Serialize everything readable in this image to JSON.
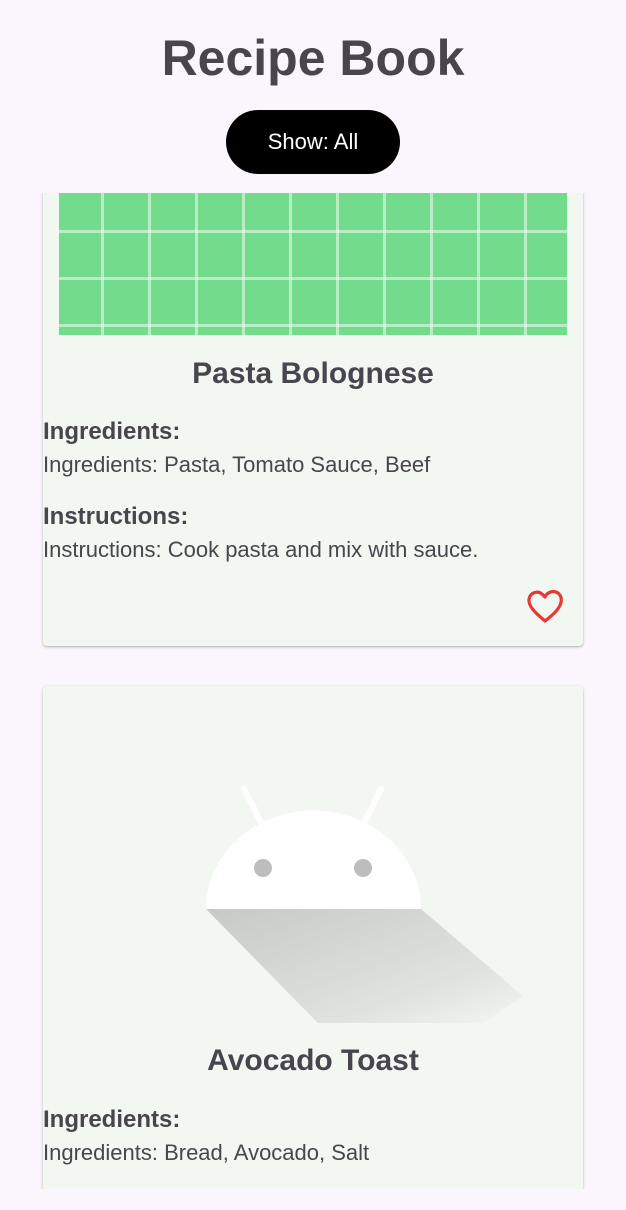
{
  "header": {
    "title": "Recipe Book",
    "filter_label": "Show: All"
  },
  "recipes": [
    {
      "title": "Pasta Bolognese",
      "ingredients_heading": "Ingredients:",
      "ingredients": "Ingredients: Pasta, Tomato Sauce, Beef",
      "instructions_heading": "Instructions:",
      "instructions": "Instructions: Cook pasta and mix with sauce.",
      "image_icon": "green-grid-image",
      "favorite_icon": "heart-outline-icon",
      "favorite": false
    },
    {
      "title": "Avocado Toast",
      "ingredients_heading": "Ingredients:",
      "ingredients": "Ingredients: Bread, Avocado, Salt",
      "image_icon": "android-placeholder-image"
    }
  ],
  "colors": {
    "background": "#fbf6fd",
    "card": "#f3f7f2",
    "text": "#48454e",
    "button": "#000000",
    "favorite": "#e53935",
    "grid_image": "#72db8c"
  }
}
